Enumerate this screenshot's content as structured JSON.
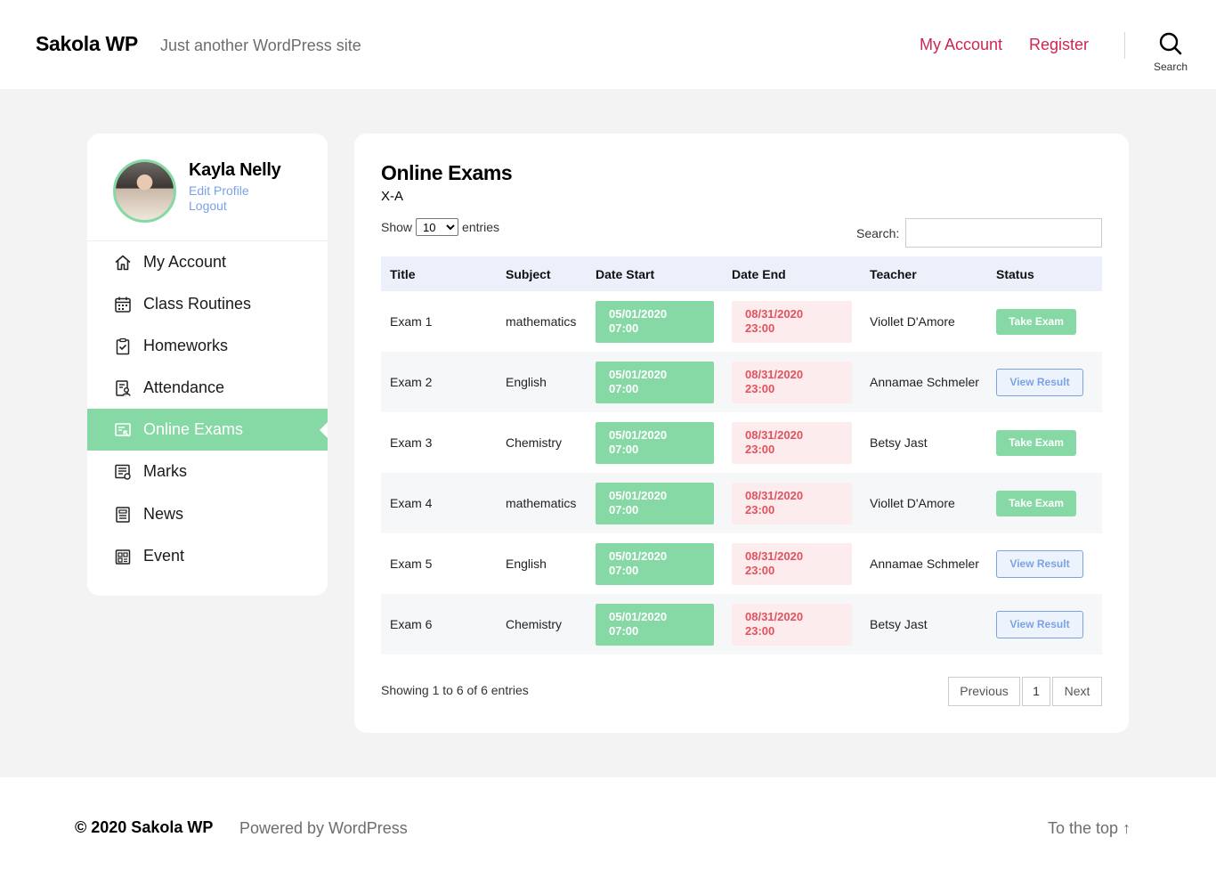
{
  "header": {
    "site_title": "Sakola WP",
    "site_description": "Just another WordPress site",
    "nav": {
      "my_account": "My Account",
      "register": "Register"
    },
    "search_label": "Search"
  },
  "sidebar": {
    "profile": {
      "name": "Kayla Nelly",
      "edit_profile": "Edit Profile",
      "logout": "Logout"
    },
    "items": [
      {
        "label": "My Account",
        "icon": "home-icon"
      },
      {
        "label": "Class Routines",
        "icon": "calendar-icon"
      },
      {
        "label": "Homeworks",
        "icon": "clipboard-check-icon"
      },
      {
        "label": "Attendance",
        "icon": "attendance-icon"
      },
      {
        "label": "Online Exams",
        "icon": "online-exam-icon",
        "active": true
      },
      {
        "label": "Marks",
        "icon": "marks-icon"
      },
      {
        "label": "News",
        "icon": "news-icon"
      },
      {
        "label": "Event",
        "icon": "event-icon"
      }
    ]
  },
  "main": {
    "title": "Online Exams",
    "subtitle": "X-A",
    "length": {
      "show": "Show",
      "value": "10",
      "entries": "entries"
    },
    "search_label": "Search:",
    "columns": [
      "Title",
      "Subject",
      "Date Start",
      "Date End",
      "Teacher",
      "Status"
    ],
    "rows": [
      {
        "title": "Exam 1",
        "subject": "mathematics",
        "start_date": "05/01/2020",
        "start_time": "07:00",
        "end_date": "08/31/2020",
        "end_time": "23:00",
        "teacher": "Viollet D'Amore",
        "status": "Take Exam"
      },
      {
        "title": "Exam 2",
        "subject": "English",
        "start_date": "05/01/2020",
        "start_time": "07:00",
        "end_date": "08/31/2020",
        "end_time": "23:00",
        "teacher": "Annamae Schmeler",
        "status": "View Result"
      },
      {
        "title": "Exam 3",
        "subject": "Chemistry",
        "start_date": "05/01/2020",
        "start_time": "07:00",
        "end_date": "08/31/2020",
        "end_time": "23:00",
        "teacher": "Betsy Jast",
        "status": "Take Exam"
      },
      {
        "title": "Exam 4",
        "subject": "mathematics",
        "start_date": "05/01/2020",
        "start_time": "07:00",
        "end_date": "08/31/2020",
        "end_time": "23:00",
        "teacher": "Viollet D'Amore",
        "status": "Take Exam"
      },
      {
        "title": "Exam 5",
        "subject": "English",
        "start_date": "05/01/2020",
        "start_time": "07:00",
        "end_date": "08/31/2020",
        "end_time": "23:00",
        "teacher": "Annamae Schmeler",
        "status": "View Result"
      },
      {
        "title": "Exam 6",
        "subject": "Chemistry",
        "start_date": "05/01/2020",
        "start_time": "07:00",
        "end_date": "08/31/2020",
        "end_time": "23:00",
        "teacher": "Betsy Jast",
        "status": "View Result"
      }
    ],
    "info": "Showing 1 to 6 of 6 entries",
    "pagination": {
      "previous": "Previous",
      "page": "1",
      "next": "Next"
    }
  },
  "footer": {
    "copyright": "© 2020 Sakola WP",
    "powered": "Powered by WordPress",
    "to_top": "To the top ↑"
  },
  "colors": {
    "accent": "#cd2653",
    "green": "#86d9a5",
    "link_blue": "#7aa3e5",
    "end_date_bg": "#fdeced",
    "end_date_text": "#e0525e",
    "table_head_bg": "#ebf0fa"
  }
}
